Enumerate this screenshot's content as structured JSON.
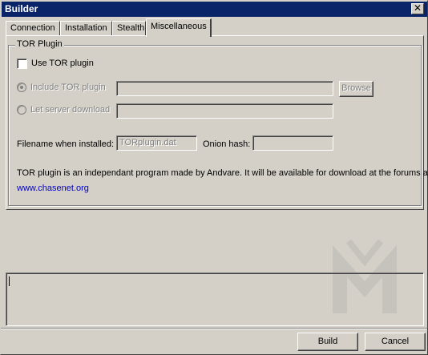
{
  "window": {
    "title": "Builder",
    "close_glyph": "✕"
  },
  "tabs": [
    {
      "label": "Connection",
      "active": false
    },
    {
      "label": "Installation",
      "active": false
    },
    {
      "label": "Stealth",
      "active": false
    },
    {
      "label": "Miscellaneous",
      "active": true
    }
  ],
  "tor_group": {
    "legend": "TOR Plugin",
    "use_tor_label": "Use TOR plugin",
    "use_tor_checked": false,
    "include_label": "Include TOR plugin",
    "include_selected": true,
    "include_path_value": "",
    "browse_label": "Browse",
    "server_download_label": "Let server download",
    "server_download_value": "",
    "filename_label": "Filename when installed:",
    "filename_value": "TORplugin.dat",
    "onion_label": "Onion hash:",
    "onion_value": "",
    "info_text": "TOR plugin is an independant program made by Andvare. It will be available for download at the forums at",
    "forum_link": "www.chasenet.org"
  },
  "log_area": {
    "value": ""
  },
  "footer": {
    "build_label": "Build",
    "cancel_label": "Cancel"
  },
  "colors": {
    "titlebar": "#0a246a",
    "face": "#d4d0c8",
    "link": "#0000cc"
  }
}
